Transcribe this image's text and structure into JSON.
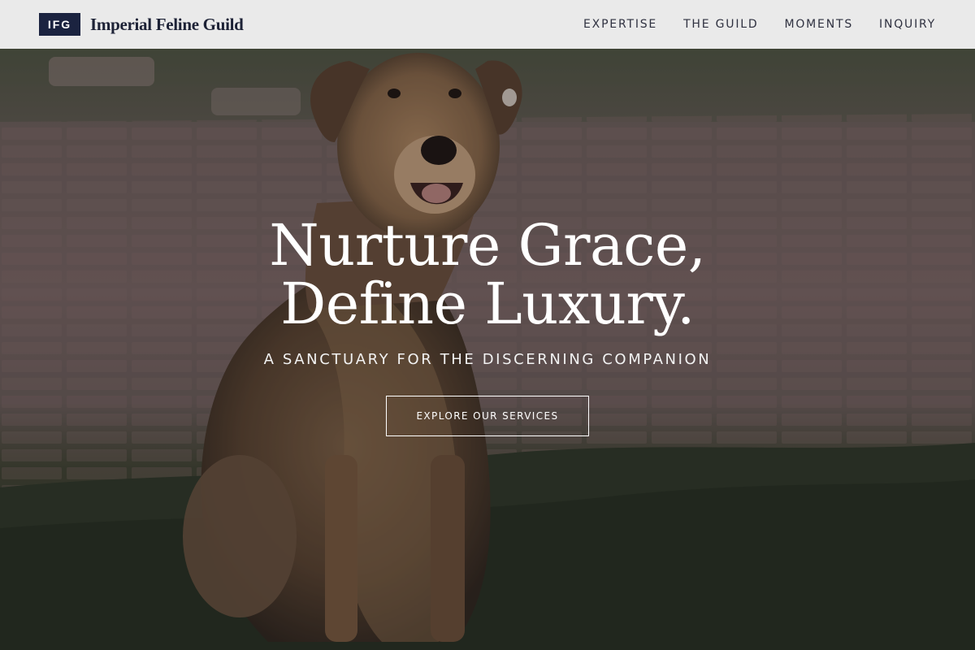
{
  "header": {
    "badge": "IFG",
    "brand_name": "Imperial Feline Guild",
    "nav": [
      {
        "label": "EXPERTISE"
      },
      {
        "label": "THE GUILD"
      },
      {
        "label": "MOMENTS"
      },
      {
        "label": "INQUIRY"
      }
    ]
  },
  "hero": {
    "title_line_1": "Nurture Grace,",
    "title_line_2": "Define Luxury.",
    "subtitle": "A SANCTUARY FOR THE DISCERNING COMPANION",
    "cta_label": "EXPLORE OUR SERVICES",
    "image_description_icon": "dog-photo"
  },
  "colors": {
    "badge_bg": "#1b2340",
    "brand_text": "#1d2236",
    "header_bg": "#f0f0f0",
    "hero_text": "#ffffff"
  }
}
